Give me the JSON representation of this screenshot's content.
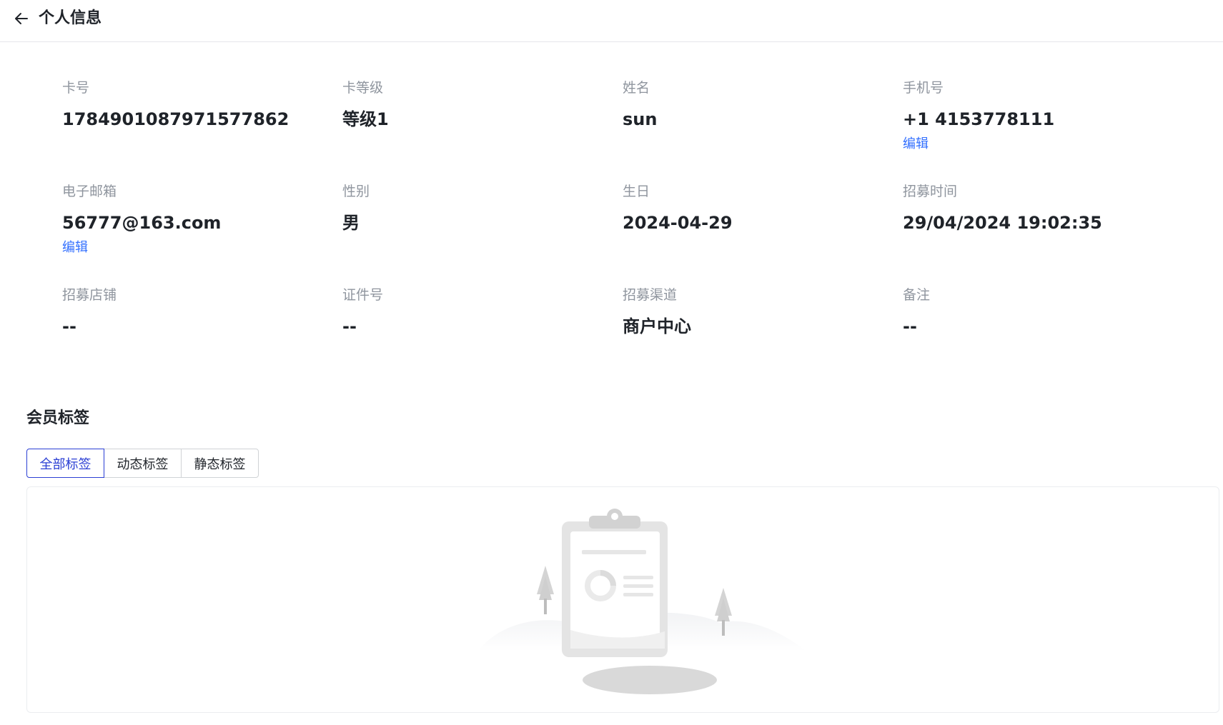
{
  "header": {
    "back_icon": "arrow-left-icon",
    "title": "个人信息"
  },
  "profile": {
    "fields": [
      {
        "label": "卡号",
        "value": "1784901087971577862"
      },
      {
        "label": "卡等级",
        "value": "等级1"
      },
      {
        "label": "姓名",
        "value": "sun"
      },
      {
        "label": "手机号",
        "value": "+1 4153778111",
        "edit": "编辑"
      },
      {
        "label": "电子邮箱",
        "value": "56777@163.com",
        "edit": "编辑"
      },
      {
        "label": "性别",
        "value": "男"
      },
      {
        "label": "生日",
        "value": "2024-04-29"
      },
      {
        "label": "招募时间",
        "value": "29/04/2024 19:02:35"
      },
      {
        "label": "招募店铺",
        "value": "--"
      },
      {
        "label": "证件号",
        "value": "--"
      },
      {
        "label": "招募渠道",
        "value": "商户中心"
      },
      {
        "label": "备注",
        "value": "--"
      }
    ]
  },
  "tags_section": {
    "title": "会员标签",
    "tabs": [
      {
        "label": "全部标签",
        "active": true
      },
      {
        "label": "动态标签",
        "active": false
      },
      {
        "label": "静态标签",
        "active": false
      }
    ],
    "empty_icon": "empty-clipboard-illustration"
  },
  "colors": {
    "link": "#3370ff",
    "active_tab": "#2b3fd4",
    "label_gray": "#8f959e",
    "text_dark": "#1f2329"
  }
}
